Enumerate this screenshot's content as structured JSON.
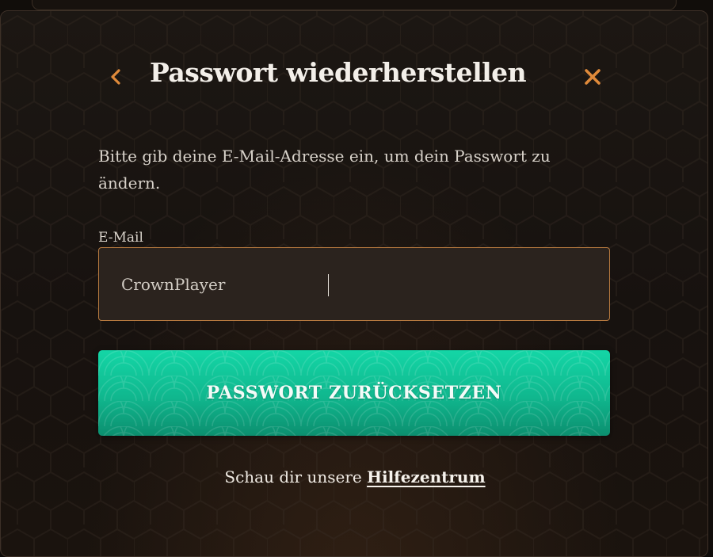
{
  "dialog": {
    "title": "Passwort wiederherstellen",
    "back_icon": "chevron-left-icon",
    "close_icon": "close-icon",
    "accent_color": "#e08a3a"
  },
  "form": {
    "description": "Bitte gib deine E-Mail-Adresse ein, um dein Passwort zu ändern.",
    "email_label": "E-Mail",
    "email_value": "CrownPlayer",
    "submit_label": "PASSWORT ZURÜCKSETZEN",
    "submit_color": "#12c79b"
  },
  "help": {
    "prefix": "Schau dir unsere ",
    "link_label": "Hilfezentrum"
  }
}
